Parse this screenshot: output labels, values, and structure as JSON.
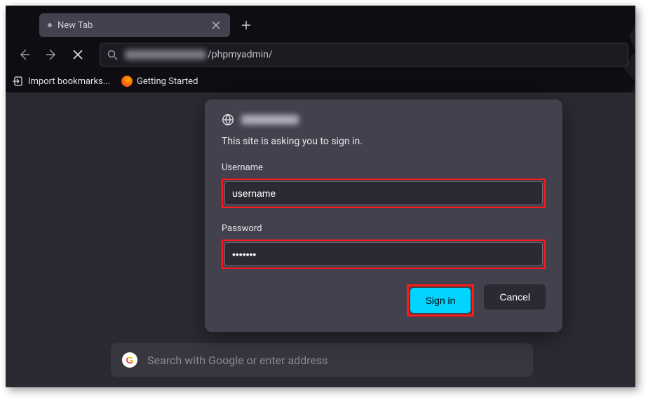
{
  "tab": {
    "title": "New Tab",
    "loading_indicator": "•"
  },
  "url": {
    "visible_path": "/phpmyadmin/"
  },
  "bookmarks": {
    "import_label": "Import bookmarks...",
    "getting_started_label": "Getting Started"
  },
  "auth_dialog": {
    "message": "This site is asking you to sign in.",
    "username_label": "Username",
    "username_value": "username",
    "password_label": "Password",
    "password_value": "•••••••",
    "signin_label": "Sign in",
    "cancel_label": "Cancel"
  },
  "new_tab_search": {
    "placeholder": "Search with Google or enter address"
  },
  "highlights": {
    "color": "#ff1a1a"
  }
}
